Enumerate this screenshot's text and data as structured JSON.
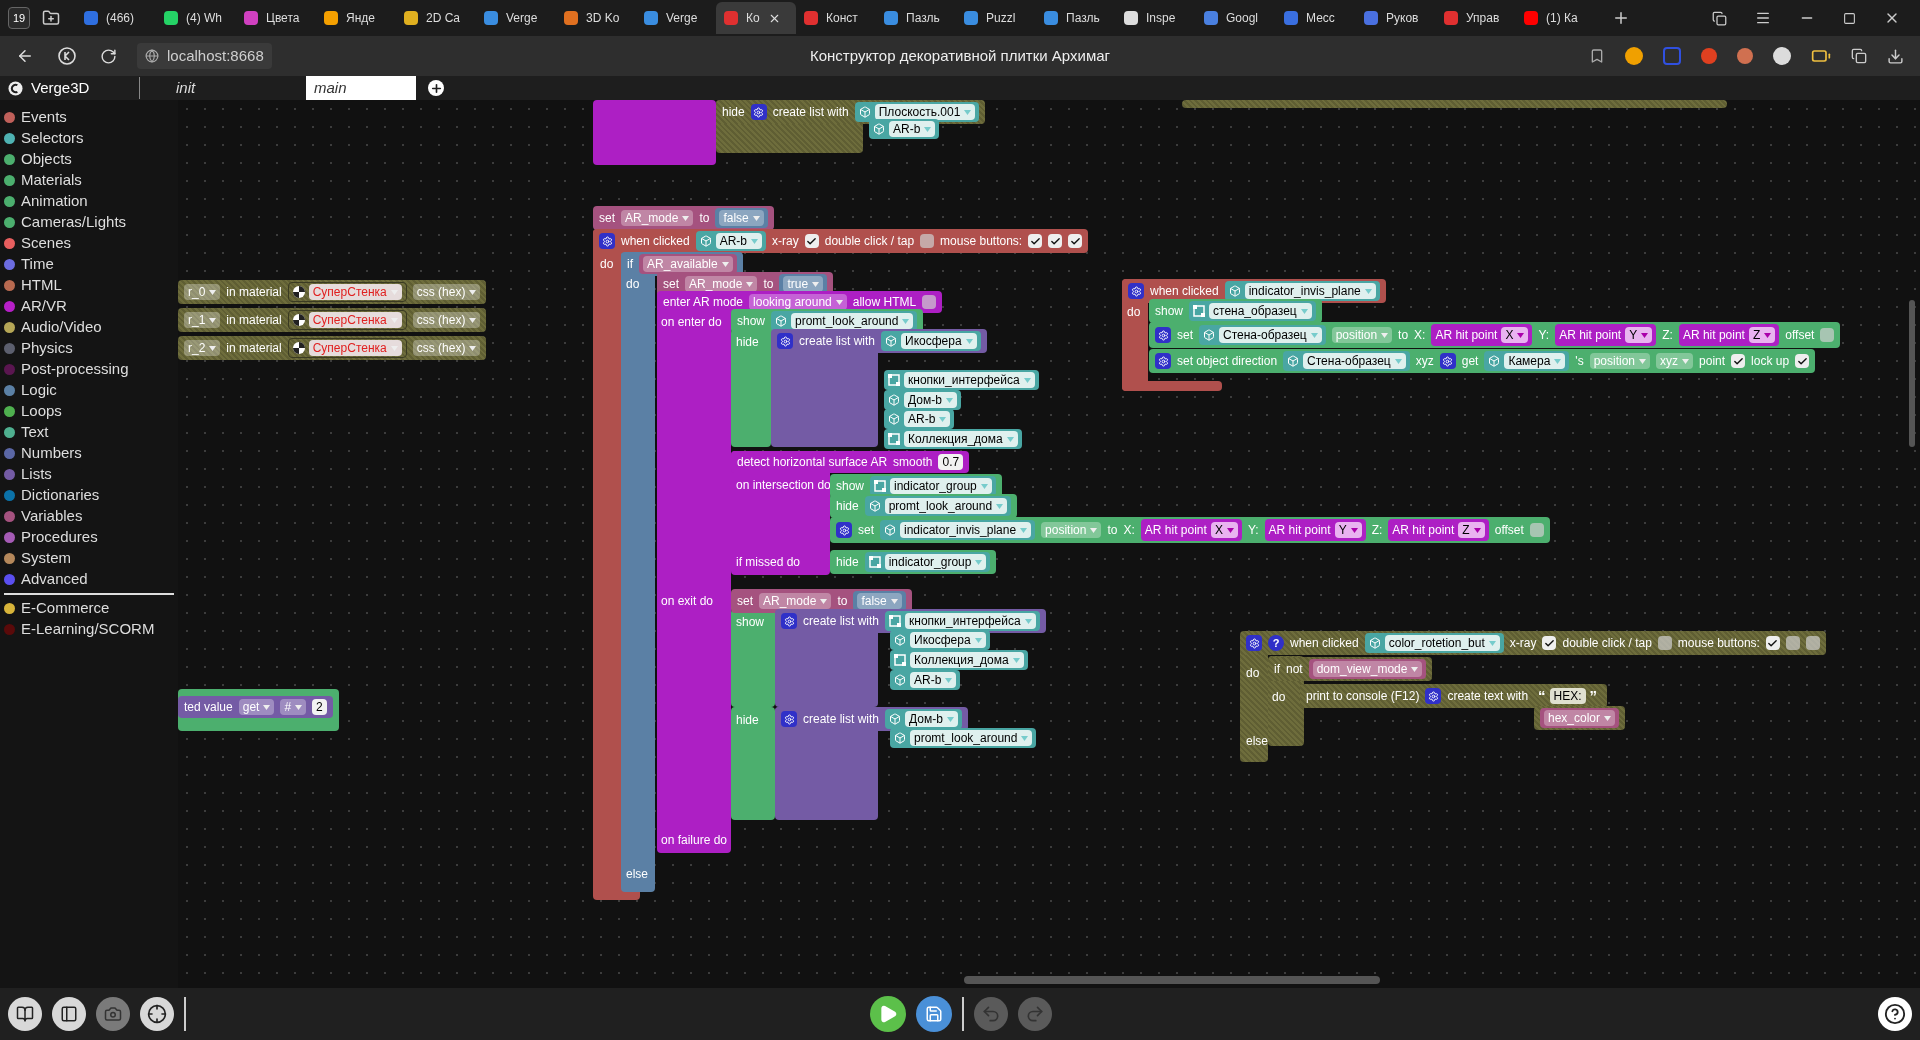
{
  "browser": {
    "tab_count": "19",
    "tabs": [
      {
        "title": "(466)",
        "selected": false,
        "color": "#2f6fe0"
      },
      {
        "title": "(4) Wh",
        "selected": false,
        "color": "#25d366"
      },
      {
        "title": "Цвета",
        "selected": false,
        "color": "#d040c0"
      },
      {
        "title": "Янде",
        "selected": false,
        "color": "#f5a000"
      },
      {
        "title": "2D Ca",
        "selected": false,
        "color": "#e0b020"
      },
      {
        "title": "Verge",
        "selected": false,
        "color": "#3a8de0"
      },
      {
        "title": "3D Ko",
        "selected": false,
        "color": "#e07020"
      },
      {
        "title": "Verge",
        "selected": false,
        "color": "#3a8de0"
      },
      {
        "title": "Ко",
        "selected": true,
        "color": "#e03030"
      },
      {
        "title": "Конст",
        "selected": false,
        "color": "#e03030"
      },
      {
        "title": "Пазль",
        "selected": false,
        "color": "#3a8de0"
      },
      {
        "title": "Puzzl",
        "selected": false,
        "color": "#3a8de0"
      },
      {
        "title": "Пазль",
        "selected": false,
        "color": "#3a8de0"
      },
      {
        "title": "Inspe",
        "selected": false,
        "color": "#dddddd"
      },
      {
        "title": "Googl",
        "selected": false,
        "color": "#4a80e0"
      },
      {
        "title": "Месс",
        "selected": false,
        "color": "#3a6fe0"
      },
      {
        "title": "Руков",
        "selected": false,
        "color": "#4a70e0"
      },
      {
        "title": "Управ",
        "selected": false,
        "color": "#e03030"
      },
      {
        "title": "(1) Ка",
        "selected": false,
        "color": "#ff0000"
      }
    ],
    "address": "localhost:8668",
    "page_title": "Конструктор декоративной плитки Архимаг"
  },
  "editor": {
    "product": "Verge3D",
    "tabs": [
      {
        "label": "init",
        "selected": false
      },
      {
        "label": "main",
        "selected": true
      }
    ]
  },
  "sidebar": {
    "categories": [
      {
        "label": "Events",
        "color": "#c0605a"
      },
      {
        "label": "Selectors",
        "color": "#4fb3b3"
      },
      {
        "label": "Objects",
        "color": "#4caf6e"
      },
      {
        "label": "Materials",
        "color": "#4caf6e"
      },
      {
        "label": "Animation",
        "color": "#4caf6e"
      },
      {
        "label": "Cameras/Lights",
        "color": "#4caf6e"
      },
      {
        "label": "Scenes",
        "color": "#e85f5f"
      },
      {
        "label": "Time",
        "color": "#6c6ce0"
      },
      {
        "label": "HTML",
        "color": "#b86a50"
      },
      {
        "label": "AR/VR",
        "color": "#b61fc7"
      },
      {
        "label": "Audio/Video",
        "color": "#b5a656"
      },
      {
        "label": "Physics",
        "color": "#5c5f6e"
      },
      {
        "label": "Post-processing",
        "color": "#5a1650"
      },
      {
        "label": "Logic",
        "color": "#5b80a5"
      },
      {
        "label": "Loops",
        "color": "#4fb04f"
      },
      {
        "label": "Text",
        "color": "#4fb090"
      },
      {
        "label": "Numbers",
        "color": "#5b67a5"
      },
      {
        "label": "Lists",
        "color": "#745ba5"
      },
      {
        "label": "Dictionaries",
        "color": "#0b72a8"
      },
      {
        "label": "Variables",
        "color": "#a5527f"
      },
      {
        "label": "Procedures",
        "color": "#a55bb5"
      },
      {
        "label": "System",
        "color": "#b5885b"
      },
      {
        "label": "Advanced",
        "color": "#5b4ff0"
      }
    ],
    "extras": [
      {
        "label": "E-Commerce",
        "color": "#d8b43a"
      },
      {
        "label": "E-Learning/SCORM",
        "color": "#5a0a0a"
      }
    ]
  },
  "workspace": {
    "rows": [
      {
        "kind": "disabled",
        "parts": [
          {
            "kind": "label",
            "text": "hide"
          },
          {
            "kind": "mutator"
          },
          {
            "kind": "label",
            "text": "create list with"
          },
          {
            "kind": "object",
            "text": "Плоскость.001"
          }
        ]
      },
      {
        "kind": "chip",
        "parts": [
          {
            "kind": "object",
            "text": "AR-b"
          }
        ]
      },
      {
        "kind": "disabled",
        "parts": [
          {
            "kind": "dropdown",
            "text": "r_0"
          },
          {
            "kind": "label",
            "text": "in material"
          },
          {
            "kind": "material",
            "text": "СуперСтенка"
          },
          {
            "kind": "dropdown",
            "text": "css (hex)"
          }
        ]
      },
      {
        "kind": "disabled",
        "parts": [
          {
            "kind": "dropdown",
            "text": "r_1"
          },
          {
            "kind": "label",
            "text": "in material"
          },
          {
            "kind": "material",
            "text": "СуперСтенка"
          },
          {
            "kind": "dropdown",
            "text": "css (hex)"
          }
        ]
      },
      {
        "kind": "disabled",
        "parts": [
          {
            "kind": "dropdown",
            "text": "r_2"
          },
          {
            "kind": "label",
            "text": "in material"
          },
          {
            "kind": "material",
            "text": "СуперСтенка"
          },
          {
            "kind": "dropdown",
            "text": "css (hex)"
          }
        ]
      },
      {
        "kind": "variable",
        "parts": [
          {
            "kind": "label",
            "text": "set"
          },
          {
            "kind": "dropdown",
            "text": "AR_mode"
          },
          {
            "kind": "label",
            "text": "to"
          },
          {
            "kind": "logic_value",
            "text": "false"
          }
        ]
      },
      {
        "kind": "event",
        "parts": [
          {
            "kind": "mutator"
          },
          {
            "kind": "label",
            "text": "when clicked"
          },
          {
            "kind": "object",
            "text": "AR-b"
          },
          {
            "kind": "label",
            "text": "x-ray"
          },
          {
            "kind": "checkbox",
            "checked": true
          },
          {
            "kind": "label",
            "text": "double click / tap"
          },
          {
            "kind": "checkbox",
            "checked": false
          },
          {
            "kind": "label",
            "text": "mouse buttons:"
          },
          {
            "kind": "checkbox",
            "checked": true
          },
          {
            "kind": "checkbox",
            "checked": true
          },
          {
            "kind": "checkbox",
            "checked": true
          }
        ]
      },
      {
        "kind": "plain",
        "parts": [
          {
            "kind": "label",
            "text": "do"
          }
        ]
      },
      {
        "kind": "logic",
        "parts": [
          {
            "kind": "label",
            "text": "if"
          },
          {
            "kind": "variable",
            "text": "AR_available"
          }
        ]
      },
      {
        "kind": "plain",
        "parts": [
          {
            "kind": "label",
            "text": "do"
          }
        ]
      },
      {
        "kind": "variable",
        "parts": [
          {
            "kind": "label",
            "text": "set"
          },
          {
            "kind": "dropdown",
            "text": "AR_mode"
          },
          {
            "kind": "label",
            "text": "to"
          },
          {
            "kind": "logic_value",
            "text": "true"
          }
        ]
      },
      {
        "kind": "ar",
        "parts": [
          {
            "kind": "label",
            "text": "enter AR mode"
          },
          {
            "kind": "dropdown",
            "text": "looking around"
          },
          {
            "kind": "label",
            "text": "allow HTML"
          },
          {
            "kind": "checkbox",
            "checked": false
          }
        ]
      },
      {
        "kind": "plain",
        "parts": [
          {
            "kind": "label",
            "text": "on enter do"
          }
        ]
      },
      {
        "kind": "objects",
        "parts": [
          {
            "kind": "label",
            "text": "show"
          },
          {
            "kind": "object",
            "text": "promt_look_around"
          }
        ]
      },
      {
        "kind": "plain",
        "parts": [
          {
            "kind": "label",
            "text": "hide"
          }
        ]
      },
      {
        "kind": "list",
        "parts": [
          {
            "kind": "mutator"
          },
          {
            "kind": "label",
            "text": "create list with"
          },
          {
            "kind": "object",
            "text": "Икосфера"
          }
        ]
      },
      {
        "kind": "chip",
        "parts": [
          {
            "kind": "group",
            "text": "кнопки_интерфейса"
          }
        ]
      },
      {
        "kind": "chip",
        "parts": [
          {
            "kind": "object",
            "text": "Дом-b"
          }
        ]
      },
      {
        "kind": "chip",
        "parts": [
          {
            "kind": "object",
            "text": "AR-b"
          }
        ]
      },
      {
        "kind": "chip",
        "parts": [
          {
            "kind": "group",
            "text": "Коллекция_дома"
          }
        ]
      },
      {
        "kind": "ar",
        "parts": [
          {
            "kind": "label",
            "text": "detect horizontal surface AR"
          },
          {
            "kind": "label",
            "text": "smooth"
          },
          {
            "kind": "value",
            "text": "0.7"
          }
        ]
      },
      {
        "kind": "plain",
        "parts": [
          {
            "kind": "label",
            "text": "on intersection do"
          }
        ]
      },
      {
        "kind": "objects",
        "parts": [
          {
            "kind": "label",
            "text": "show"
          },
          {
            "kind": "group",
            "text": "indicator_group"
          }
        ]
      },
      {
        "kind": "objects",
        "parts": [
          {
            "kind": "label",
            "text": "hide"
          },
          {
            "kind": "object",
            "text": "promt_look_around"
          }
        ]
      },
      {
        "kind": "objects",
        "parts": [
          {
            "kind": "mutator"
          },
          {
            "kind": "label",
            "text": "set"
          },
          {
            "kind": "object",
            "text": "indicator_invis_plane"
          },
          {
            "kind": "dropdown",
            "text": "position"
          },
          {
            "kind": "label",
            "text": "to"
          },
          {
            "kind": "label",
            "text": "X:"
          },
          {
            "kind": "ar_value",
            "text": "AR hit point",
            "option": "X"
          },
          {
            "kind": "label",
            "text": "Y:"
          },
          {
            "kind": "ar_value",
            "text": "AR hit point",
            "option": "Y"
          },
          {
            "kind": "label",
            "text": "Z:"
          },
          {
            "kind": "ar_value",
            "text": "AR hit point",
            "option": "Z"
          },
          {
            "kind": "label",
            "text": "offset"
          },
          {
            "kind": "checkbox",
            "checked": false
          }
        ]
      },
      {
        "kind": "plain",
        "parts": [
          {
            "kind": "label",
            "text": "if missed do"
          }
        ]
      },
      {
        "kind": "objects",
        "parts": [
          {
            "kind": "label",
            "text": "hide"
          },
          {
            "kind": "group",
            "text": "indicator_group"
          }
        ]
      },
      {
        "kind": "plain",
        "parts": [
          {
            "kind": "label",
            "text": "on exit do"
          }
        ]
      },
      {
        "kind": "variable",
        "parts": [
          {
            "kind": "label",
            "text": "set"
          },
          {
            "kind": "dropdown",
            "text": "AR_mode"
          },
          {
            "kind": "label",
            "text": "to"
          },
          {
            "kind": "logic_value",
            "text": "false"
          }
        ]
      },
      {
        "kind": "plain",
        "parts": [
          {
            "kind": "label",
            "text": "show"
          }
        ]
      },
      {
        "kind": "list",
        "parts": [
          {
            "kind": "mutator"
          },
          {
            "kind": "label",
            "text": "create list with"
          },
          {
            "kind": "group",
            "text": "кнопки_интерфейса"
          }
        ]
      },
      {
        "kind": "chip",
        "parts": [
          {
            "kind": "object",
            "text": "Икосфера"
          }
        ]
      },
      {
        "kind": "chip",
        "parts": [
          {
            "kind": "group",
            "text": "Коллекция_дома"
          }
        ]
      },
      {
        "kind": "chip",
        "parts": [
          {
            "kind": "object",
            "text": "AR-b"
          }
        ]
      },
      {
        "kind": "plain",
        "parts": [
          {
            "kind": "label",
            "text": "hide"
          }
        ]
      },
      {
        "kind": "list",
        "parts": [
          {
            "kind": "mutator"
          },
          {
            "kind": "label",
            "text": "create list with"
          },
          {
            "kind": "object",
            "text": "Дом-b"
          }
        ]
      },
      {
        "kind": "chip",
        "parts": [
          {
            "kind": "object",
            "text": "promt_look_around"
          }
        ]
      },
      {
        "kind": "plain",
        "parts": [
          {
            "kind": "label",
            "text": "on failure do"
          }
        ]
      },
      {
        "kind": "plain",
        "parts": [
          {
            "kind": "label",
            "text": "else"
          }
        ]
      },
      {
        "kind": "event",
        "parts": [
          {
            "kind": "mutator"
          },
          {
            "kind": "label",
            "text": "when clicked"
          },
          {
            "kind": "object",
            "text": "indicator_invis_plane"
          }
        ]
      },
      {
        "kind": "plain",
        "parts": [
          {
            "kind": "label",
            "text": "do"
          }
        ]
      },
      {
        "kind": "objects",
        "parts": [
          {
            "kind": "label",
            "text": "show"
          },
          {
            "kind": "group",
            "text": "стена_образец"
          }
        ]
      },
      {
        "kind": "objects",
        "parts": [
          {
            "kind": "mutator"
          },
          {
            "kind": "label",
            "text": "set"
          },
          {
            "kind": "object",
            "text": "Стена-образец"
          },
          {
            "kind": "dropdown",
            "text": "position"
          },
          {
            "kind": "label",
            "text": "to"
          },
          {
            "kind": "label",
            "text": "X:"
          },
          {
            "kind": "ar_value",
            "text": "AR hit point",
            "option": "X"
          },
          {
            "kind": "label",
            "text": "Y:"
          },
          {
            "kind": "ar_value",
            "text": "AR hit point",
            "option": "Y"
          },
          {
            "kind": "label",
            "text": "Z:"
          },
          {
            "kind": "ar_value",
            "text": "AR hit point",
            "option": "Z"
          },
          {
            "kind": "label",
            "text": "offset"
          },
          {
            "kind": "checkbox",
            "checked": false
          }
        ]
      },
      {
        "kind": "objects",
        "parts": [
          {
            "kind": "mutator"
          },
          {
            "kind": "label",
            "text": "set object direction"
          },
          {
            "kind": "object",
            "text": "Стена-образец"
          },
          {
            "kind": "label",
            "text": "xyz"
          },
          {
            "kind": "mutator"
          },
          {
            "kind": "label",
            "text": "get"
          },
          {
            "kind": "object",
            "text": "Камера"
          },
          {
            "kind": "label",
            "text": "'s"
          },
          {
            "kind": "dropdown",
            "text": "position"
          },
          {
            "kind": "dropdown",
            "text": "xyz"
          },
          {
            "kind": "label",
            "text": "point"
          },
          {
            "kind": "checkbox",
            "checked": true
          },
          {
            "kind": "label",
            "text": "lock up"
          },
          {
            "kind": "checkbox",
            "checked": true
          }
        ]
      },
      {
        "kind": "disabled",
        "parts": [
          {
            "kind": "mutator"
          },
          {
            "kind": "help",
            "text": "?"
          },
          {
            "kind": "label",
            "text": "when clicked"
          },
          {
            "kind": "object",
            "text": "color_rotetion_but"
          },
          {
            "kind": "label",
            "text": "x-ray"
          },
          {
            "kind": "checkbox",
            "checked": true
          },
          {
            "kind": "label",
            "text": "double click / tap"
          },
          {
            "kind": "checkbox",
            "checked": false
          },
          {
            "kind": "label",
            "text": "mouse buttons:"
          },
          {
            "kind": "checkbox",
            "checked": true
          },
          {
            "kind": "checkbox",
            "checked": false
          },
          {
            "kind": "checkbox",
            "checked": false
          }
        ]
      },
      {
        "kind": "plain",
        "parts": [
          {
            "kind": "label",
            "text": "do"
          }
        ]
      },
      {
        "kind": "disabled",
        "parts": [
          {
            "kind": "label",
            "text": "if"
          },
          {
            "kind": "label",
            "text": "not"
          },
          {
            "kind": "variable",
            "text": "dom_view_mode"
          }
        ]
      },
      {
        "kind": "plain",
        "parts": [
          {
            "kind": "label",
            "text": "do"
          }
        ]
      },
      {
        "kind": "disabled",
        "parts": [
          {
            "kind": "label",
            "text": "print to console (F12)"
          },
          {
            "kind": "mutator"
          },
          {
            "kind": "label",
            "text": "create text with"
          },
          {
            "kind": "string",
            "text": "HEX:",
            "open": "“",
            "close": "”"
          }
        ]
      },
      {
        "kind": "disabled",
        "parts": [
          {
            "kind": "variable",
            "text": "hex_color"
          }
        ]
      },
      {
        "kind": "plain",
        "parts": [
          {
            "kind": "label",
            "text": "else"
          }
        ]
      },
      {
        "kind": "list",
        "parts": [
          {
            "kind": "label",
            "text": "ted value"
          },
          {
            "kind": "dropdown",
            "text": "get"
          },
          {
            "kind": "dropdown",
            "text": "#"
          },
          {
            "kind": "value",
            "text": "2"
          }
        ]
      }
    ]
  }
}
